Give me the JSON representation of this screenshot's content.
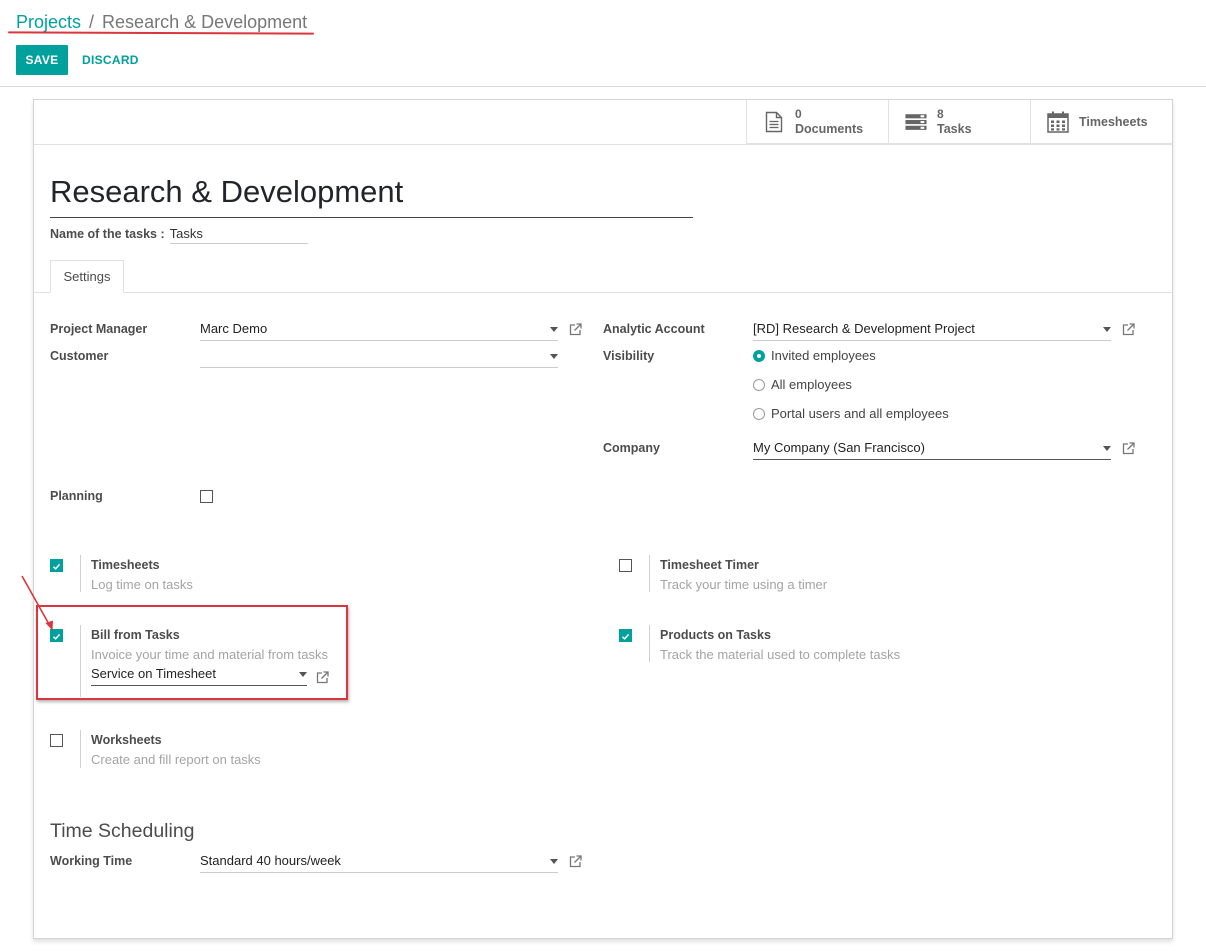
{
  "breadcrumb": {
    "parent": "Projects",
    "separator": "/",
    "current": "Research & Development"
  },
  "actions": {
    "save": "SAVE",
    "discard": "DISCARD"
  },
  "smart_buttons": [
    {
      "count": "0",
      "label": "Documents",
      "icon": "document-icon"
    },
    {
      "count": "8",
      "label": "Tasks",
      "icon": "tasks-icon"
    },
    {
      "count": "",
      "label": "Timesheets",
      "icon": "calendar-icon"
    }
  ],
  "form": {
    "title": "Research & Development",
    "task_name_label": "Name of the tasks :",
    "task_name_value": "Tasks"
  },
  "tabs": {
    "active": "Settings"
  },
  "settings": {
    "project_manager_label": "Project Manager",
    "project_manager_value": "Marc Demo",
    "customer_label": "Customer",
    "customer_value": "",
    "analytic_label": "Analytic Account",
    "analytic_value": "[RD] Research & Development Project",
    "visibility_label": "Visibility",
    "visibility_options": [
      "Invited employees",
      "All employees",
      "Portal users and all employees"
    ],
    "visibility_selected": 0,
    "company_label": "Company",
    "company_value": "My Company (San Francisco)",
    "planning_label": "Planning",
    "planning_checked": false
  },
  "features": {
    "timesheets": {
      "title": "Timesheets",
      "desc": "Log time on tasks",
      "checked": true
    },
    "timesheet_timer": {
      "title": "Timesheet Timer",
      "desc": "Track your time using a timer",
      "checked": false
    },
    "bill_from_tasks": {
      "title": "Bill from Tasks",
      "desc": "Invoice your time and material from tasks",
      "checked": true,
      "product_value": "Service on Timesheet"
    },
    "products_on_tasks": {
      "title": "Products on Tasks",
      "desc": "Track the material used to complete tasks",
      "checked": true
    },
    "worksheets": {
      "title": "Worksheets",
      "desc": "Create and fill report on tasks",
      "checked": false
    }
  },
  "time_scheduling": {
    "section_title": "Time Scheduling",
    "working_time_label": "Working Time",
    "working_time_value": "Standard 40 hours/week"
  },
  "colors": {
    "accent": "#00a09d",
    "annotation": "#d9363e"
  }
}
